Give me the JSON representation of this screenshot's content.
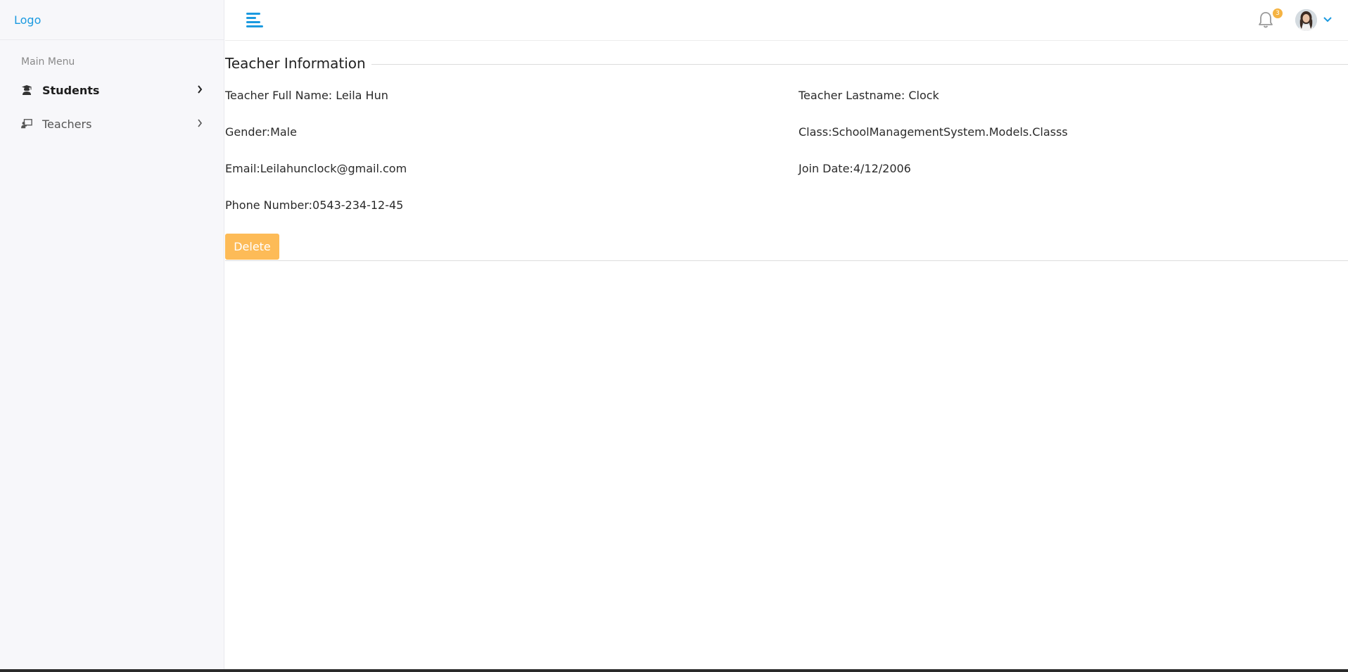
{
  "sidebar": {
    "logo": "Logo",
    "menu_title": "Main Menu",
    "items": [
      {
        "label": "Students",
        "icon": "graduate-icon"
      },
      {
        "label": "Teachers",
        "icon": "chalkboard-teacher-icon"
      }
    ]
  },
  "header": {
    "notification_count": "3"
  },
  "teacher": {
    "section_title": "Teacher Information",
    "full_name": "Teacher Full Name: Leila Hun",
    "lastname": "Teacher Lastname: Clock",
    "gender": "Gender:Male",
    "class": "Class:SchoolManagementSystem.Models.Classs",
    "email": "Email:Leilahunclock@gmail.com",
    "join_date": "Join Date:4/12/2006",
    "phone": "Phone Number:0543-234-12-45",
    "delete_label": "Delete"
  },
  "colors": {
    "accent": "#1b9ae0",
    "delete_button": "#fdbb57",
    "badge": "#f5b342",
    "sidebar_bg": "#f7f7fa"
  }
}
